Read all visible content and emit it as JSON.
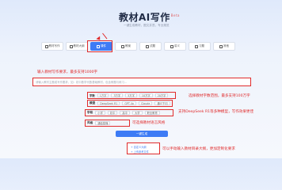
{
  "header": {
    "title": "教材AI写作",
    "beta": "Beta",
    "subtitle": "一键生成教材，图文并茂，专业规范"
  },
  "tabs": [
    {
      "label": "教材写作",
      "icon": "book-icon",
      "active": false
    },
    {
      "label": "教材大纲",
      "icon": "list-icon",
      "active": false
    },
    {
      "label": "课件",
      "icon": "slides-icon",
      "active": true
    },
    {
      "label": "教案",
      "icon": "doc-icon",
      "active": false
    },
    {
      "label": "试题",
      "icon": "quiz-icon",
      "active": false
    },
    {
      "label": "讲义",
      "icon": "note-icon",
      "active": false
    },
    {
      "label": "习题",
      "icon": "pencil-icon",
      "active": false
    },
    {
      "label": "其他",
      "icon": "more-icon",
      "active": false
    }
  ],
  "annotations": {
    "topic": "输入教材写作要求，最多支持1000字",
    "wordcount": "选择教材字数范围，最多支持100万字",
    "model": "支持DeepSeek R1等多种模型，写作效果更佳",
    "style": "可选择教材语言风格",
    "outline": "可以手动输入教材目录大纲，更加定制化要求"
  },
  "topic_input": {
    "placeholder": "请输入教材主题或写作要求，如：初中数学代数基础教材，包含例题与练习...",
    "value": ""
  },
  "settings": {
    "wordcount": {
      "label": "字数",
      "options": [
        "1万字",
        "3万字",
        "5万字",
        "10万字",
        "20万字"
      ]
    },
    "model": {
      "label": "模型",
      "options": [
        "DeepSeek R1",
        "GPT-4o",
        "Claude",
        "通义千问"
      ]
    },
    "level": {
      "label": "学段",
      "options": [
        "小学",
        "初中",
        "高中",
        "大学",
        "职业教育"
      ]
    },
    "style": {
      "label": "风格",
      "value": "通俗易懂"
    }
  },
  "generate_button": {
    "label": "一键生成"
  },
  "outline": {
    "line1": "+ 自定义大纲",
    "line2": "+ 上传参考文件"
  },
  "colors": {
    "accent": "#3d7bf5",
    "annotation_red": "#e02b2b"
  }
}
